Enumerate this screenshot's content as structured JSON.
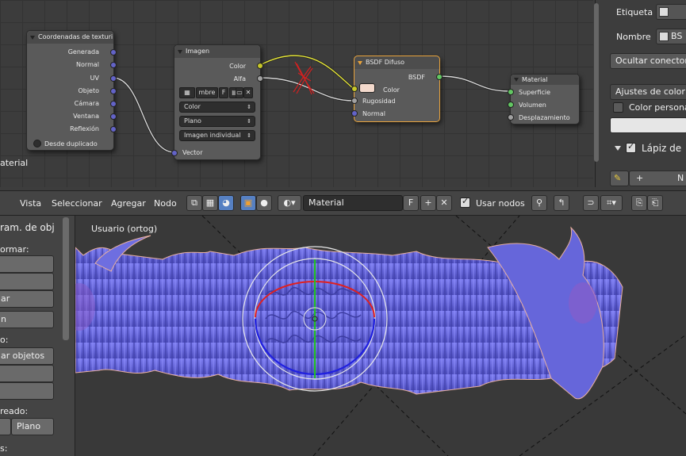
{
  "nodes": {
    "texcoord": {
      "title": "Coordenadas de texturi",
      "outputs": [
        "Generada",
        "Normal",
        "UV",
        "Objeto",
        "Cámara",
        "Ventana",
        "Reflexión"
      ],
      "from_dupli": "Desde duplicado"
    },
    "image": {
      "title": "Imagen",
      "outputs": [
        "Color",
        "Alfa"
      ],
      "image_name": "mbre",
      "fake_user": "F",
      "color_space": "Color",
      "projection": "Plano",
      "source": "Imagen individual",
      "input": "Vector"
    },
    "diffuse": {
      "title": "BSDF Difuso",
      "output": "BSDF",
      "inputs": [
        "Color",
        "Rugosidad",
        "Normal"
      ]
    },
    "material_out": {
      "title": "Material",
      "inputs": [
        "Superficie",
        "Volumen",
        "Desplazamiento"
      ]
    },
    "cut_label": "aterial"
  },
  "props": {
    "label_label": "Etiqueta",
    "name_label": "Nombre",
    "name_value": "BS",
    "hide_sockets": "Ocultar conectores",
    "color_settings": "Ajustes de color",
    "custom_color": "Color personalizado",
    "grease_pencil": "Lápiz de",
    "new_label": "N"
  },
  "header": {
    "menus": [
      "Vista",
      "Seleccionar",
      "Agregar",
      "Nodo"
    ],
    "material_name": "Material",
    "fake_user": "F",
    "use_nodes": "Usar nodos"
  },
  "toolshelf": {
    "panel_title": "ram. de obj",
    "transform_label": "ormar:",
    "transform_btns": [
      "",
      "",
      "ar"
    ],
    "btn_n": "n",
    "section2_label": "o:",
    "join_btn": "ar objetos",
    "more_btns": [
      "",
      ""
    ],
    "shading_label": "reado:",
    "smooth_btn": "",
    "flat_btn": "Plano",
    "bottom_label": "s:"
  },
  "viewport": {
    "view_label": "Usuario (ortog)"
  },
  "colors": {
    "accent_blue": "#5680c2",
    "active_node_outline": "#e8a33c",
    "mesh_color": "#6a6ad8"
  }
}
